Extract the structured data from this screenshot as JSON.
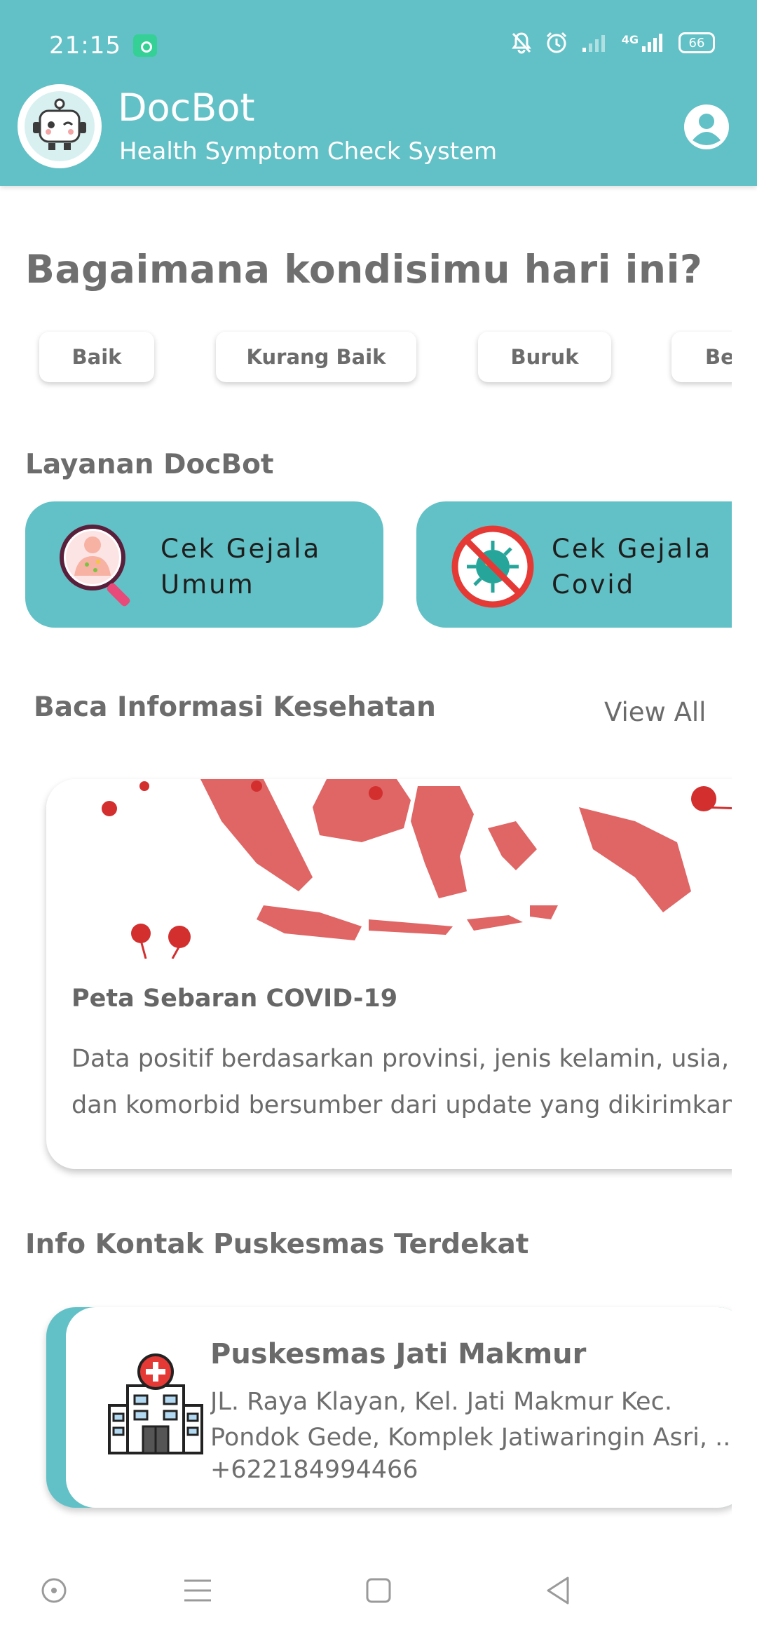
{
  "status_bar": {
    "time": "21:15",
    "network": "4G",
    "battery": "66"
  },
  "header": {
    "title": "DocBot",
    "subtitle": "Health Symptom Check System",
    "logo_icon": "robot-logo-icon",
    "profile_icon": "account-circle-icon"
  },
  "mood": {
    "question": "Bagaimana kondisimu hari ini?",
    "options": [
      "Baik",
      "Kurang Baik",
      "Buruk",
      "Be"
    ]
  },
  "services": {
    "title": "Layanan DocBot",
    "items": [
      {
        "label": "Cek Gejala\nUmum",
        "icon": "magnifier-body-icon"
      },
      {
        "label": "Cek Gejala\nCovid",
        "icon": "no-virus-icon"
      }
    ]
  },
  "news": {
    "title": "Baca Informasi Kesehatan",
    "view_all": "View All",
    "items": [
      {
        "title": "Peta Sebaran COVID-19",
        "desc_line1": "Data positif berdasarkan provinsi, jenis kelamin, usia, g",
        "desc_line2": "dan komorbid bersumber dari update yang dikirimkan d",
        "image": "indonesia-map-image"
      }
    ]
  },
  "contacts": {
    "title": "Info Kontak Puskesmas Terdekat",
    "items": [
      {
        "name": "Puskesmas Jati Makmur",
        "address_line1": "JL. Raya Klayan, Kel. Jati Makmur Kec.",
        "address_line2": "Pondok Gede, Komplek Jatiwaringin Asri, ...",
        "phone": "+622184994466",
        "icon": "hospital-icon"
      }
    ]
  },
  "colors": {
    "primary": "#62c1c6",
    "text": "#6b6b6b",
    "accent_red": "#e53935"
  }
}
